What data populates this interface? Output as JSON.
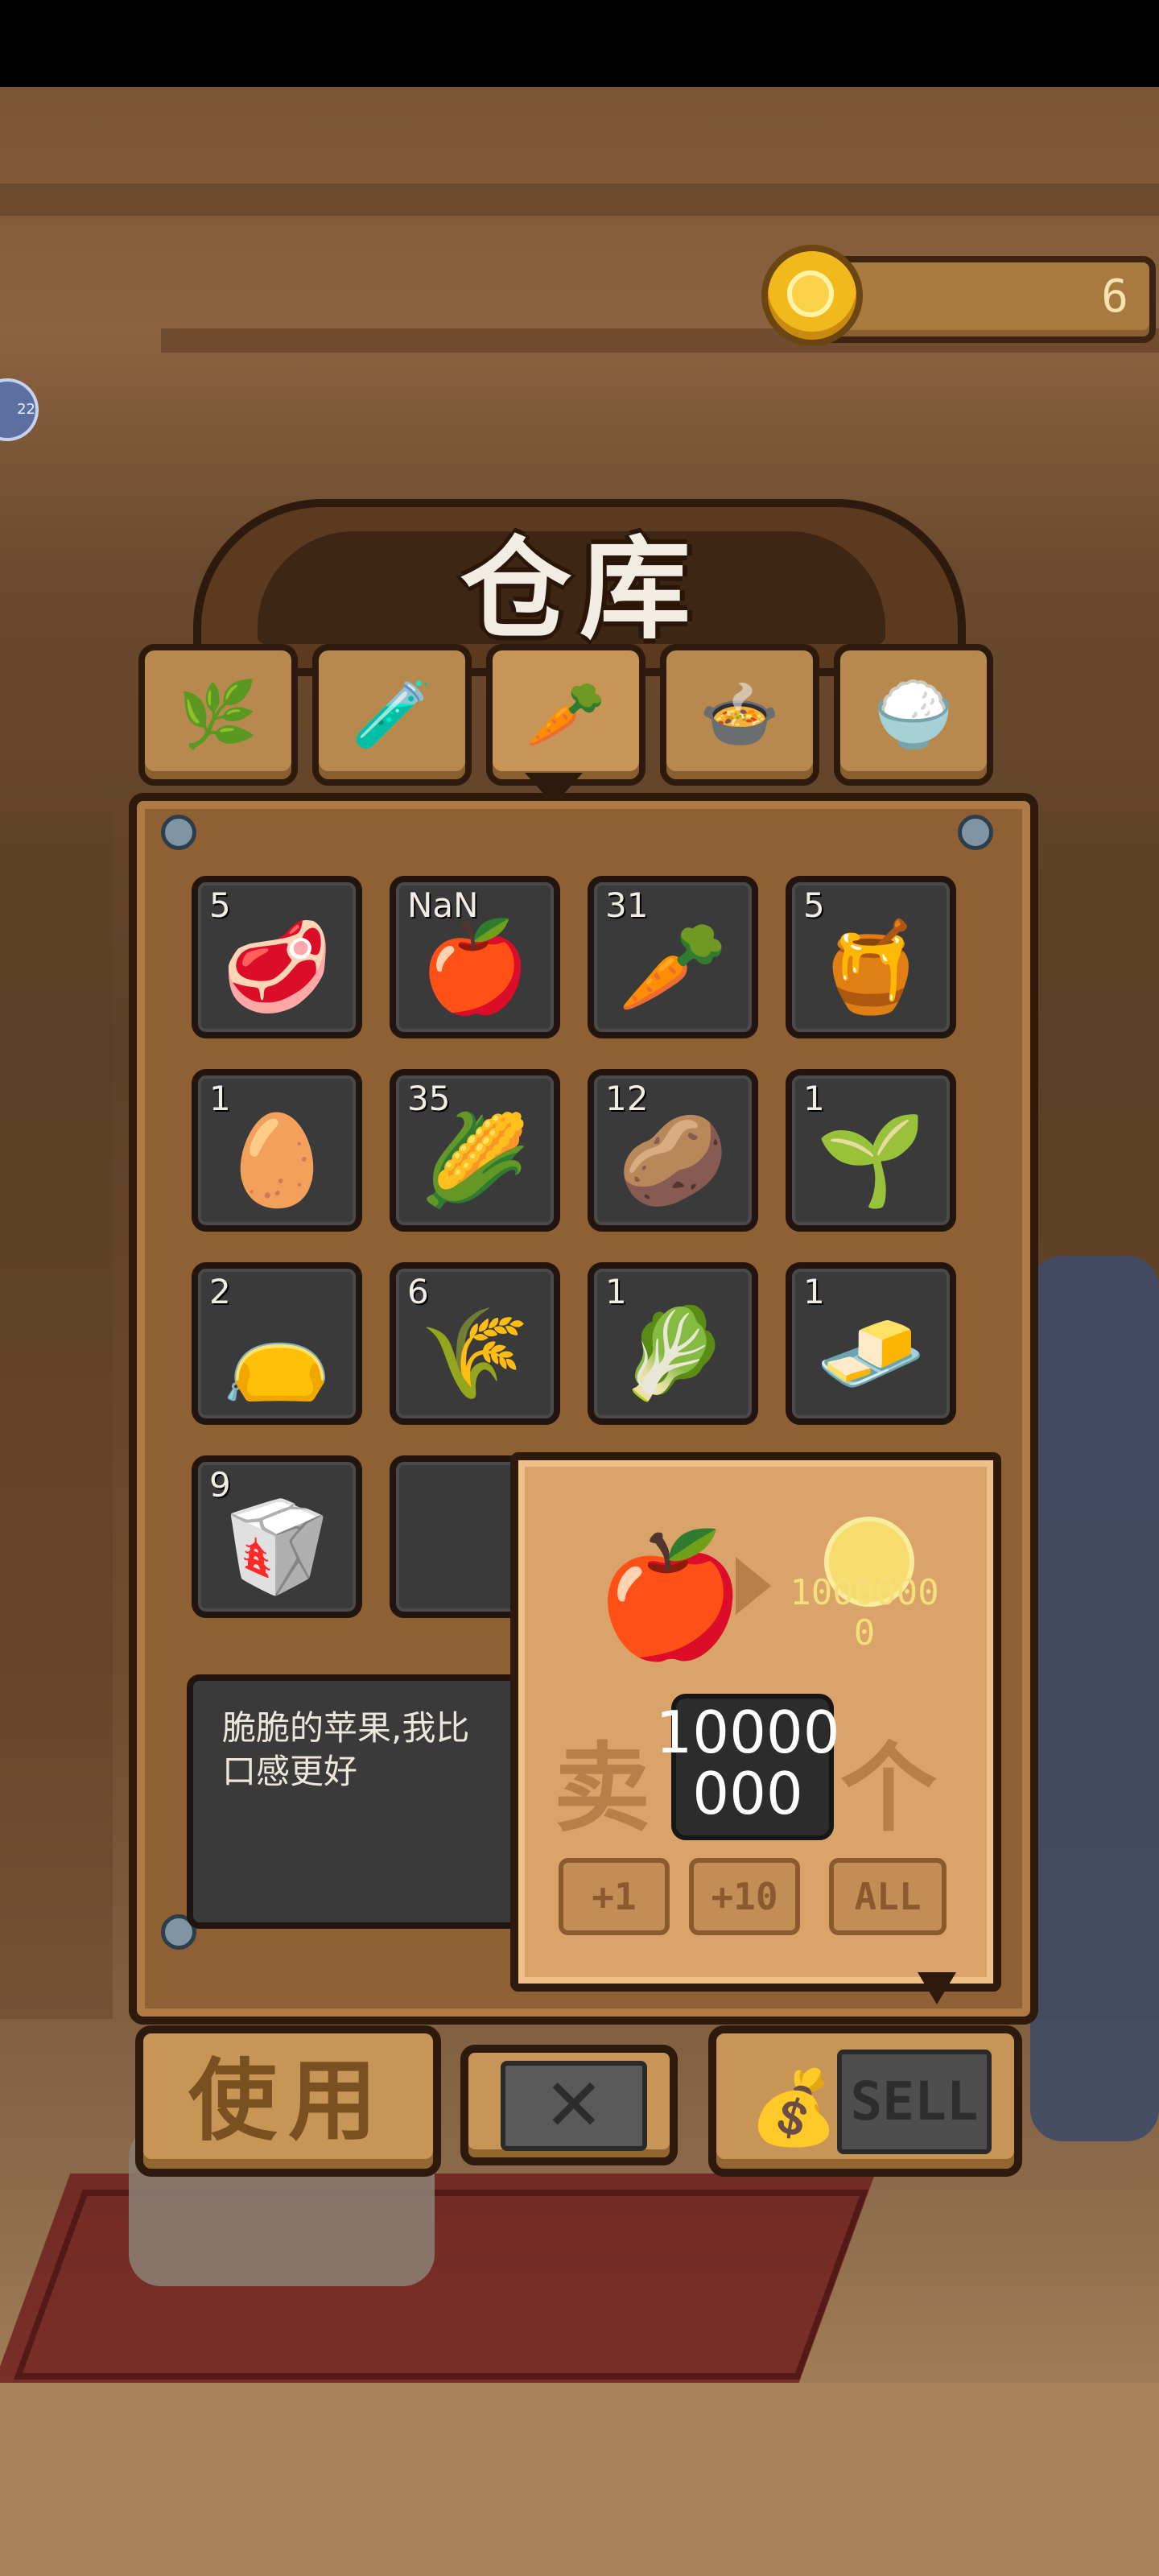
{
  "coins": {
    "value": "6"
  },
  "side_badge": "22",
  "title": "仓库",
  "tabs": [
    {
      "name": "plants",
      "icon": "🌿",
      "active": false
    },
    {
      "name": "seeds",
      "icon": "🧪",
      "active": false
    },
    {
      "name": "ingredients",
      "icon": "🥕",
      "active": true
    },
    {
      "name": "dishes",
      "icon": "🍲",
      "active": false
    },
    {
      "name": "misc",
      "icon": "🍚",
      "active": false
    }
  ],
  "inventory": [
    {
      "item": "meat",
      "icon": "🥩",
      "count": "5"
    },
    {
      "item": "apple",
      "icon": "🍎",
      "count": "NaN"
    },
    {
      "item": "carrot",
      "icon": "🥕",
      "count": "31"
    },
    {
      "item": "honey",
      "icon": "🍯",
      "count": "5"
    },
    {
      "item": "egg",
      "icon": "🥚",
      "count": "1"
    },
    {
      "item": "corn",
      "icon": "🌽",
      "count": "35"
    },
    {
      "item": "potato",
      "icon": "🥔",
      "count": "12"
    },
    {
      "item": "scallion",
      "icon": "🌱",
      "count": "1"
    },
    {
      "item": "spice-bag",
      "icon": "👝",
      "count": "2"
    },
    {
      "item": "wheat",
      "icon": "🌾",
      "count": "6"
    },
    {
      "item": "cabbage",
      "icon": "🥬",
      "count": "1"
    },
    {
      "item": "tofu",
      "icon": "🧈",
      "count": "1"
    },
    {
      "item": "flour",
      "icon": "🥡",
      "count": "9"
    },
    {
      "item": "empty",
      "icon": "",
      "count": ""
    }
  ],
  "description": "脆脆的苹果,我比\n口感更好",
  "sell_popup": {
    "item_icon": "🍎",
    "price": "10000000",
    "sell_word": "卖",
    "quantity": "10000000",
    "unit_word": "个",
    "btn_plus1": "+1",
    "btn_plus10": "+10",
    "btn_all": "ALL"
  },
  "buttons": {
    "use": "使用",
    "close": "✕",
    "sell_icon": "💰",
    "sell": "SELL"
  },
  "colors": {
    "panel": "#8e6034",
    "slot": "#3a3a3a",
    "coin": "#f2b91c",
    "popup": "#d9a36a"
  }
}
